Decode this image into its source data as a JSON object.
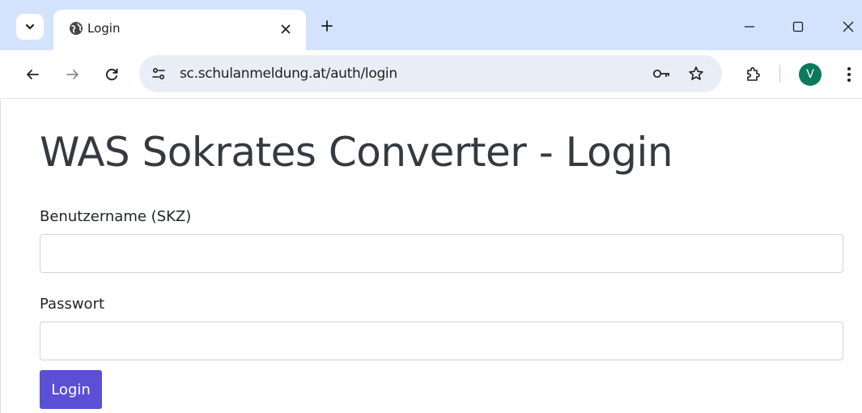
{
  "browser": {
    "tab": {
      "title": "Login"
    },
    "address_bar": {
      "url": "sc.schulanmeldung.at/auth/login"
    },
    "profile": {
      "initial": "V",
      "color": "#0b7a5c"
    },
    "tabstrip_color": "#d3e3fd"
  },
  "page": {
    "heading": "WAS Sokrates Converter - Login",
    "username": {
      "label": "Benutzername (SKZ)",
      "value": "",
      "placeholder": ""
    },
    "password": {
      "label": "Passwort",
      "value": "",
      "placeholder": ""
    },
    "submit_label": "Login",
    "accent_color": "#5b4fd6"
  }
}
